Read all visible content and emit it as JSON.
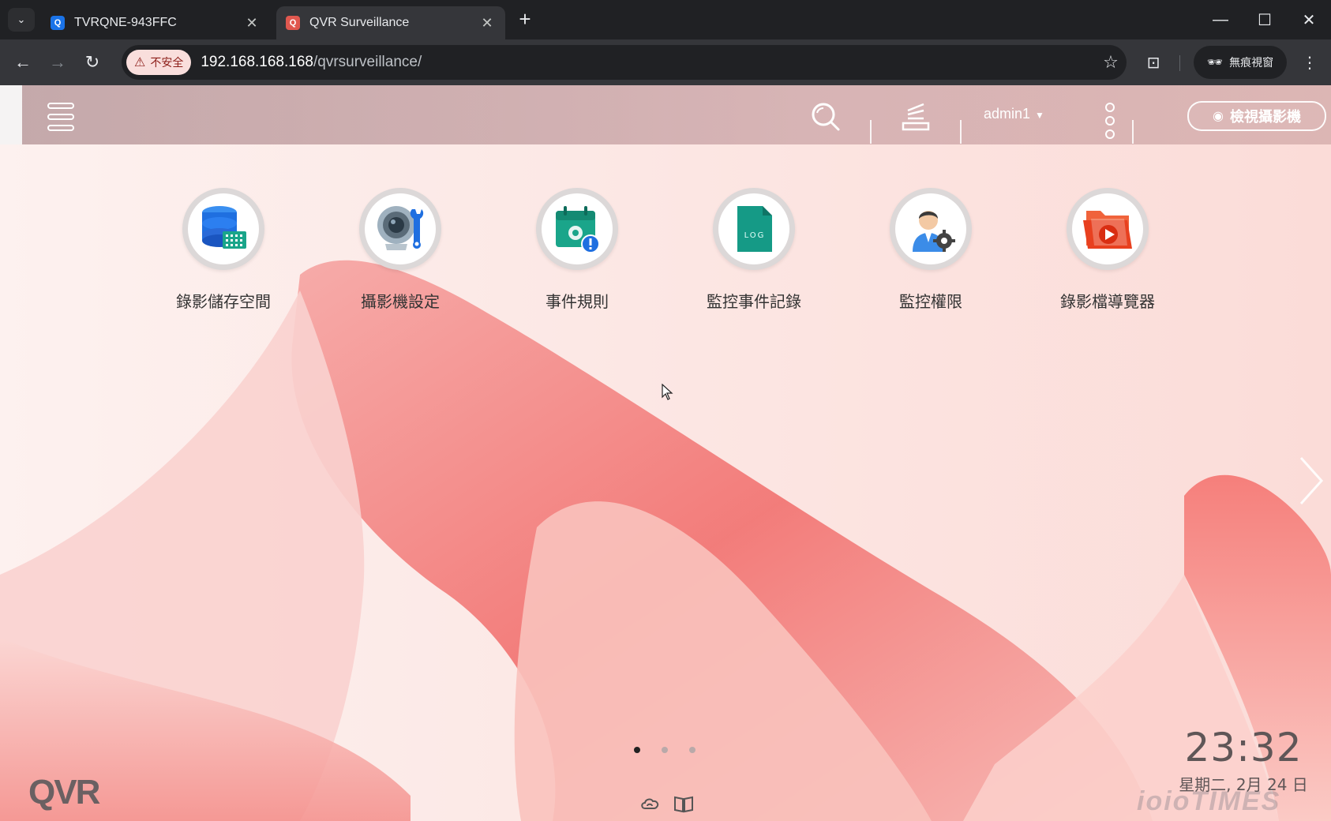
{
  "browser": {
    "tabs": [
      {
        "title": "TVRQNE-943FFC",
        "active": false,
        "favicon_color": "#1a73e8"
      },
      {
        "title": "QVR Surveillance",
        "active": true,
        "favicon_color": "#e0584f"
      }
    ],
    "address": {
      "security_label": "不安全",
      "host": "192.168.168.168",
      "path": "/qvrsurveillance/"
    },
    "incognito_label": "無痕視窗"
  },
  "header": {
    "username": "admin1",
    "view_camera_label": "檢視攝影機"
  },
  "apps": [
    {
      "label": "錄影儲存空間",
      "icon": "storage-database-icon"
    },
    {
      "label": "攝影機設定",
      "icon": "camera-settings-icon"
    },
    {
      "label": "事件規則",
      "icon": "event-rules-icon"
    },
    {
      "label": "監控事件記錄",
      "icon": "log-icon",
      "icon_text": "LOG"
    },
    {
      "label": "監控權限",
      "icon": "user-permission-icon"
    },
    {
      "label": "錄影檔導覽器",
      "icon": "recording-browser-icon"
    }
  ],
  "pagination": {
    "pages": 3,
    "current": 1
  },
  "brand": "QVR",
  "clock": {
    "time": "23:32",
    "date": "星期二, 2月 24 日"
  },
  "watermark": "ioioTIMES",
  "colors": {
    "accent": "#f26d6d",
    "chrome_dark": "#202124",
    "chrome_toolbar": "#35363a"
  }
}
